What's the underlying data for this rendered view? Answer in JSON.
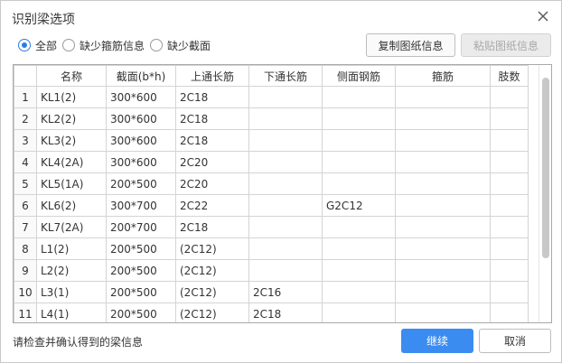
{
  "dialog": {
    "title": "识别梁选项",
    "close_icon": "close-icon"
  },
  "filters": [
    {
      "label": "全部",
      "checked": true
    },
    {
      "label": "缺少箍筋信息",
      "checked": false
    },
    {
      "label": "缺少截面",
      "checked": false
    }
  ],
  "toolbar": {
    "copy_label": "复制图纸信息",
    "paste_label": "粘贴图纸信息"
  },
  "table": {
    "columns": [
      "",
      "名称",
      "截面(b*h)",
      "上通长筋",
      "下通长筋",
      "侧面钢筋",
      "箍筋",
      "肢数"
    ],
    "rows": [
      [
        "1",
        "KL1(2)",
        "300*600",
        "2C18",
        "",
        "",
        "",
        ""
      ],
      [
        "2",
        "KL2(2)",
        "300*600",
        "2C18",
        "",
        "",
        "",
        ""
      ],
      [
        "3",
        "KL3(2)",
        "300*600",
        "2C18",
        "",
        "",
        "",
        ""
      ],
      [
        "4",
        "KL4(2A)",
        "300*600",
        "2C20",
        "",
        "",
        "",
        ""
      ],
      [
        "5",
        "KL5(1A)",
        "200*500",
        "2C20",
        "",
        "",
        "",
        ""
      ],
      [
        "6",
        "KL6(2)",
        "300*700",
        "2C22",
        "",
        "G2C12",
        "",
        ""
      ],
      [
        "7",
        "KL7(2A)",
        "200*700",
        "2C18",
        "",
        "",
        "",
        ""
      ],
      [
        "8",
        "L1(2)",
        "200*500",
        "(2C12)",
        "",
        "",
        "",
        ""
      ],
      [
        "9",
        "L2(2)",
        "200*500",
        "(2C12)",
        "",
        "",
        "",
        ""
      ],
      [
        "10",
        "L3(1)",
        "200*500",
        "(2C12)",
        "2C16",
        "",
        "",
        ""
      ],
      [
        "11",
        "L4(1)",
        "200*500",
        "(2C12)",
        "2C18",
        "",
        "",
        ""
      ]
    ]
  },
  "footer": {
    "message": "请检查并确认得到的梁信息",
    "continue_label": "继续",
    "cancel_label": "取消"
  },
  "colors": {
    "accent": "#3b8cf0",
    "radio_checked": "#2a7de1"
  }
}
